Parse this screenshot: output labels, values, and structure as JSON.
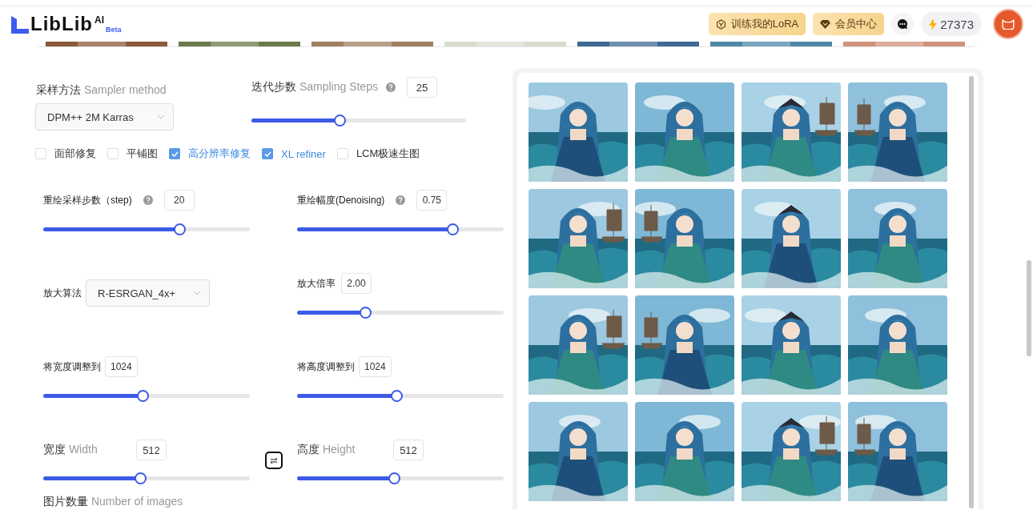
{
  "header": {
    "logo": {
      "text": "LibLib",
      "superscript": "AI",
      "badge": "Beta"
    },
    "buttons": [
      {
        "kind": "train",
        "label": "训练我的LoRA"
      },
      {
        "kind": "vip",
        "label": "会员中心"
      }
    ],
    "credits": "27373"
  },
  "sampler": {
    "label": "采样方法",
    "label_en": "Sampler method",
    "value": "DPM++ 2M Karras"
  },
  "sampling_steps": {
    "label": "迭代步数",
    "label_en": "Sampling Steps",
    "value": "25",
    "level": 0.41
  },
  "options": [
    {
      "label": "面部修复",
      "checked": false
    },
    {
      "label": "平铺图",
      "checked": false
    },
    {
      "label": "高分辨率修复",
      "checked": true
    },
    {
      "label": "XL refiner",
      "checked": true
    },
    {
      "label": "LCM极速生图",
      "checked": false
    }
  ],
  "hires": {
    "steps": {
      "label": "重绘采样步数（step)",
      "value": "20",
      "level": 0.66
    },
    "denoising": {
      "label": "重绘幅度(Denoising)",
      "value": "0.75",
      "level": 0.75
    },
    "upscaler": {
      "label": "放大算法",
      "value": "R-ESRGAN_4x+"
    },
    "scale": {
      "label": "放大倍率",
      "value": "2.00",
      "level": 0.33
    },
    "resize_width": {
      "label": "将宽度调整到",
      "value": "1024",
      "level": 0.48
    },
    "resize_height": {
      "label": "将高度调整到",
      "value": "1024",
      "level": 0.48
    }
  },
  "width": {
    "label": "宽度",
    "label_en": "Width",
    "value": "512",
    "level": 0.47
  },
  "height": {
    "label": "高度",
    "label_en": "Height",
    "value": "512",
    "level": 0.47
  },
  "image_count": {
    "label": "图片数量",
    "label_en": "Number of images"
  }
}
